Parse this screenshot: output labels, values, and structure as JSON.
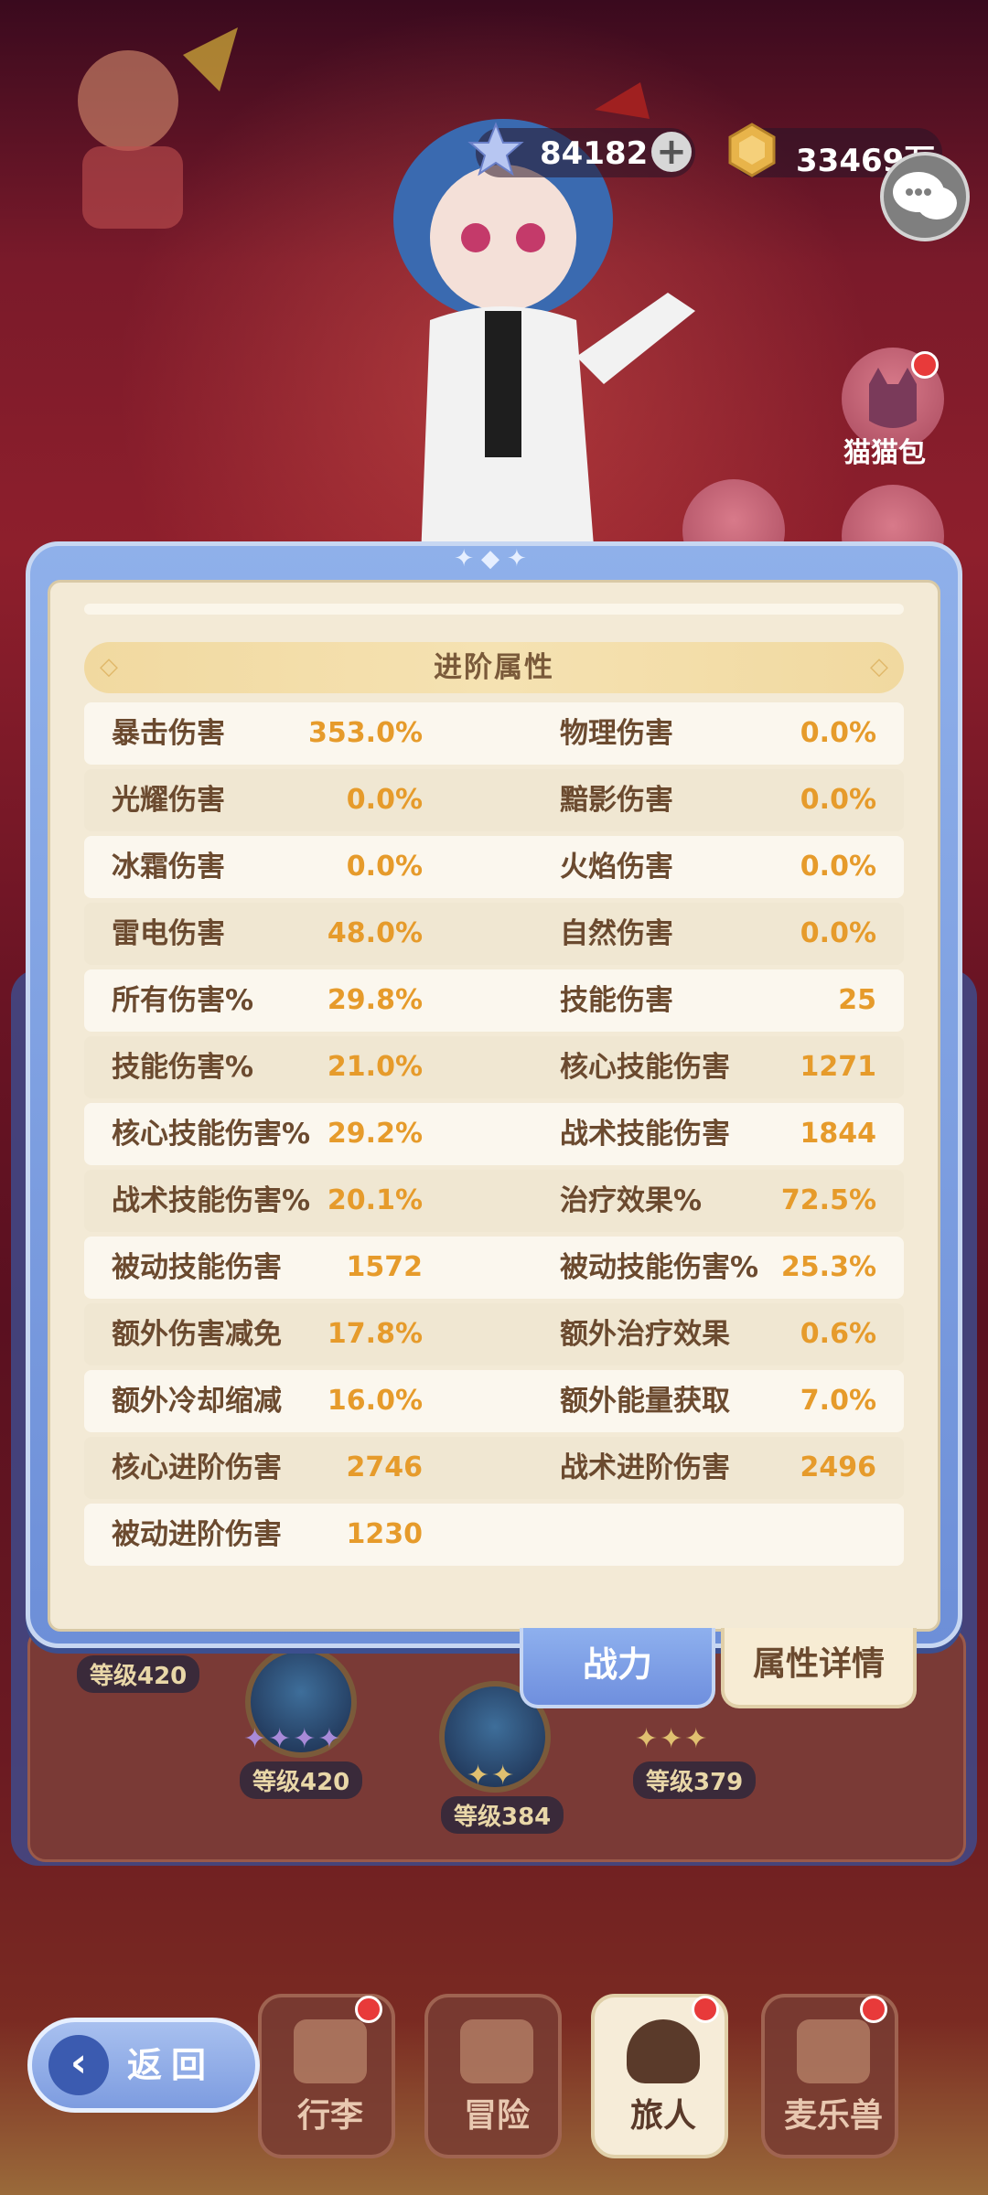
{
  "top_bar": {
    "gem_count": "84182",
    "coin_count": "33469万",
    "gem_icon": "crystal-star-icon",
    "coin_icon": "gold-coin-icon",
    "add_icon": "plus-icon",
    "chat_icon": "chat-bubbles-icon"
  },
  "side_menu": {
    "cat_bag_label": "猫猫包"
  },
  "panel": {
    "section_title": "进阶属性",
    "stats": [
      {
        "left_label": "暴击伤害",
        "left_value": "353.0%",
        "right_label": "物理伤害",
        "right_value": "0.0%"
      },
      {
        "left_label": "光耀伤害",
        "left_value": "0.0%",
        "right_label": "黯影伤害",
        "right_value": "0.0%"
      },
      {
        "left_label": "冰霜伤害",
        "left_value": "0.0%",
        "right_label": "火焰伤害",
        "right_value": "0.0%"
      },
      {
        "left_label": "雷电伤害",
        "left_value": "48.0%",
        "right_label": "自然伤害",
        "right_value": "0.0%"
      },
      {
        "left_label": "所有伤害%",
        "left_value": "29.8%",
        "right_label": "技能伤害",
        "right_value": "25"
      },
      {
        "left_label": "技能伤害%",
        "left_value": "21.0%",
        "right_label": "核心技能伤害",
        "right_value": "1271"
      },
      {
        "left_label": "核心技能伤害%",
        "left_value": "29.2%",
        "right_label": "战术技能伤害",
        "right_value": "1844"
      },
      {
        "left_label": "战术技能伤害%",
        "left_value": "20.1%",
        "right_label": "治疗效果%",
        "right_value": "72.5%"
      },
      {
        "left_label": "被动技能伤害",
        "left_value": "1572",
        "right_label": "被动技能伤害%",
        "right_value": "25.3%"
      },
      {
        "left_label": "额外伤害减免",
        "left_value": "17.8%",
        "right_label": "额外治疗效果",
        "right_value": "0.6%"
      },
      {
        "left_label": "额外冷却缩减",
        "left_value": "16.0%",
        "right_label": "额外能量获取",
        "right_value": "7.0%"
      },
      {
        "left_label": "核心进阶伤害",
        "left_value": "2746",
        "right_label": "战术进阶伤害",
        "right_value": "2496"
      },
      {
        "left_label": "被动进阶伤害",
        "left_value": "1230",
        "right_label": "",
        "right_value": ""
      }
    ]
  },
  "tabs": {
    "power": "战力",
    "details": "属性详情"
  },
  "skill_levels": {
    "a": "等级420",
    "b": "等级420",
    "c": "等级384",
    "d": "等级379"
  },
  "bottom_nav": {
    "back": "返回",
    "items": [
      {
        "label": "行李",
        "icon": "luggage-icon"
      },
      {
        "label": "冒险",
        "icon": "crossed-swords-icon"
      },
      {
        "label": "旅人",
        "icon": "traveler-portrait-icon"
      },
      {
        "label": "麦乐兽",
        "icon": "pet-fox-icon"
      }
    ]
  },
  "colors": {
    "value_orange": "#e69b2b",
    "label_brown": "#6b4a2f",
    "frame_blue": "#7d9ce0",
    "paper": "#f3ead6"
  }
}
